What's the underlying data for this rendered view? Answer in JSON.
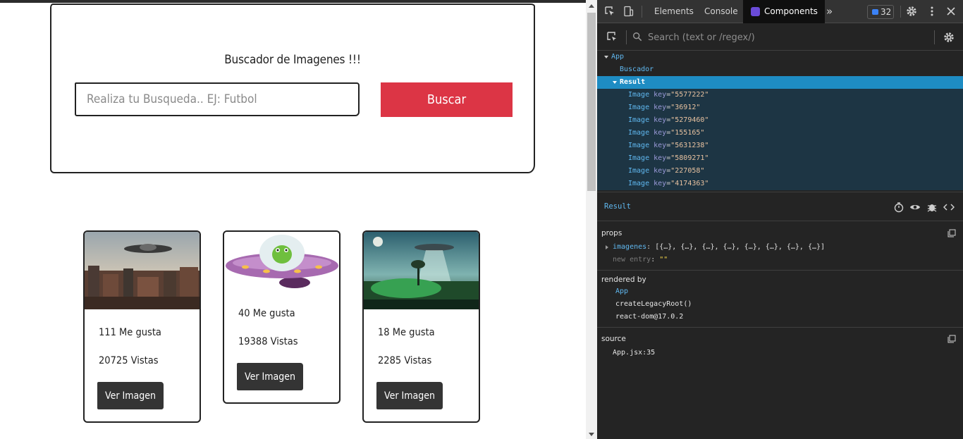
{
  "app": {
    "search": {
      "title": "Buscador de Imagenes !!!",
      "placeholder": "Realiza tu Busqueda.. EJ: Futbol",
      "button_label": "Buscar"
    },
    "cards": [
      {
        "likes": "111 Me gusta",
        "views": "20725 Vistas",
        "button_label": "Ver Imagen",
        "image": "ufo-over-ruined-city"
      },
      {
        "likes": "40 Me gusta",
        "views": "19388 Vistas",
        "button_label": "Ver Imagen",
        "image": "alien-in-flying-saucer"
      },
      {
        "likes": "18 Me gusta",
        "views": "2285 Vistas",
        "button_label": "Ver Imagen",
        "image": "ufo-over-green-landscape"
      }
    ],
    "colors": {
      "accent": "#dc3545",
      "button_dark": "#343434"
    }
  },
  "devtools": {
    "tabs": {
      "elements": "Elements",
      "console": "Console",
      "components": "Components"
    },
    "message_count": "32",
    "search_placeholder": "Search (text or /regex/)",
    "tree": {
      "app": "App",
      "buscador": "Buscador",
      "result": "Result",
      "images": [
        {
          "name": "Image",
          "key_label": "key",
          "key": "\"5577222\""
        },
        {
          "name": "Image",
          "key_label": "key",
          "key": "\"36912\""
        },
        {
          "name": "Image",
          "key_label": "key",
          "key": "\"5279460\""
        },
        {
          "name": "Image",
          "key_label": "key",
          "key": "\"155165\""
        },
        {
          "name": "Image",
          "key_label": "key",
          "key": "\"5631238\""
        },
        {
          "name": "Image",
          "key_label": "key",
          "key": "\"5809271\""
        },
        {
          "name": "Image",
          "key_label": "key",
          "key": "\"227058\""
        },
        {
          "name": "Image",
          "key_label": "key",
          "key": "\"4174363\""
        }
      ]
    },
    "selected": "Result",
    "props": {
      "title": "props",
      "imagenes_key": "imagenes",
      "imagenes_value": "[{…}, {…}, {…}, {…}, {…}, {…}, {…}, {…}]",
      "new_entry_key": "new entry",
      "new_entry_value": "\"\""
    },
    "rendered_by": {
      "title": "rendered by",
      "items": [
        "App",
        "createLegacyRoot()",
        "react-dom@17.0.2"
      ]
    },
    "source": {
      "title": "source",
      "location": "App.jsx:35"
    }
  }
}
